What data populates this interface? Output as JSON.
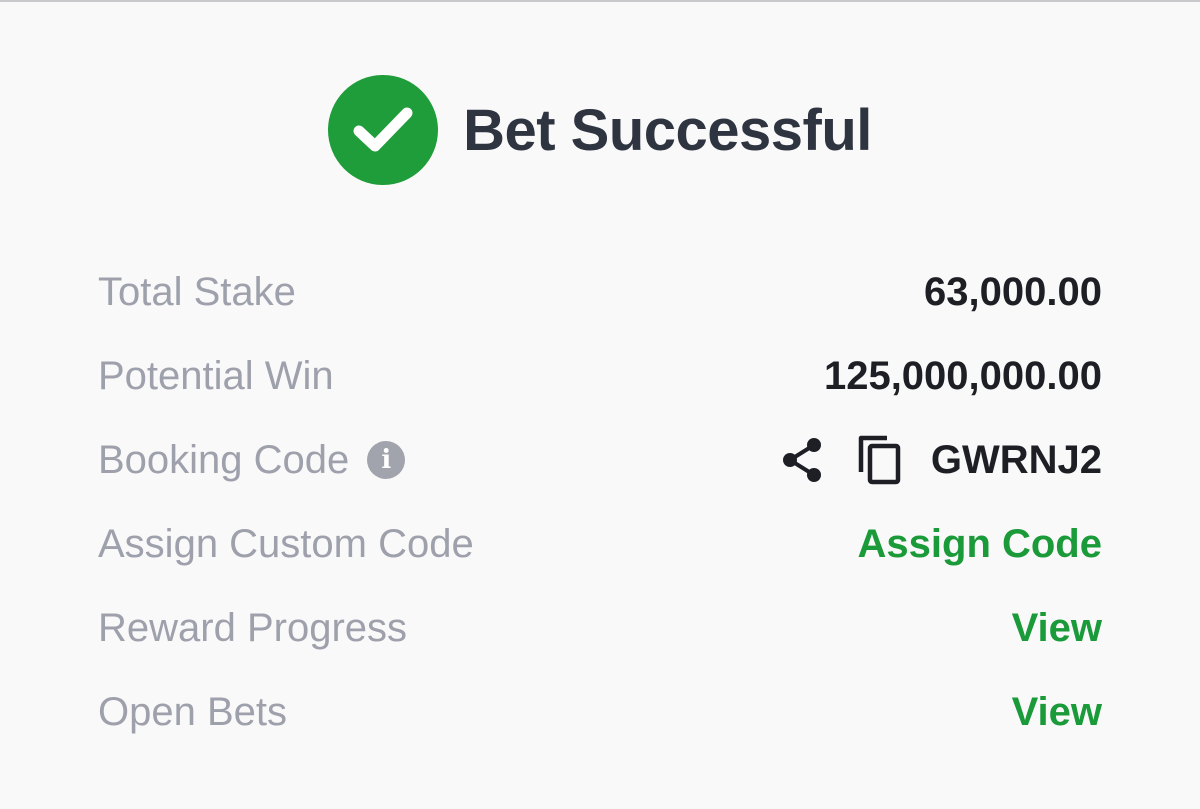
{
  "header": {
    "title": "Bet Successful",
    "icon": "check-circle-icon",
    "icon_color": "#1f9d3a"
  },
  "rows": {
    "total_stake": {
      "label": "Total Stake",
      "value": "63,000.00"
    },
    "potential_win": {
      "label": "Potential Win",
      "value": "125,000,000.00"
    },
    "booking_code": {
      "label": "Booking Code",
      "info_icon": "info-icon",
      "share_icon": "share-icon",
      "copy_icon": "copy-icon",
      "value": "GWRNJ2"
    },
    "assign_custom_code": {
      "label": "Assign Custom Code",
      "action": "Assign Code"
    },
    "reward_progress": {
      "label": "Reward Progress",
      "action": "View"
    },
    "open_bets": {
      "label": "Open Bets",
      "action": "View"
    }
  },
  "colors": {
    "accent_green": "#1a9a39",
    "label_gray": "#9ea1ab",
    "value_dark": "#1d1f24",
    "background": "#f9f9fa"
  }
}
